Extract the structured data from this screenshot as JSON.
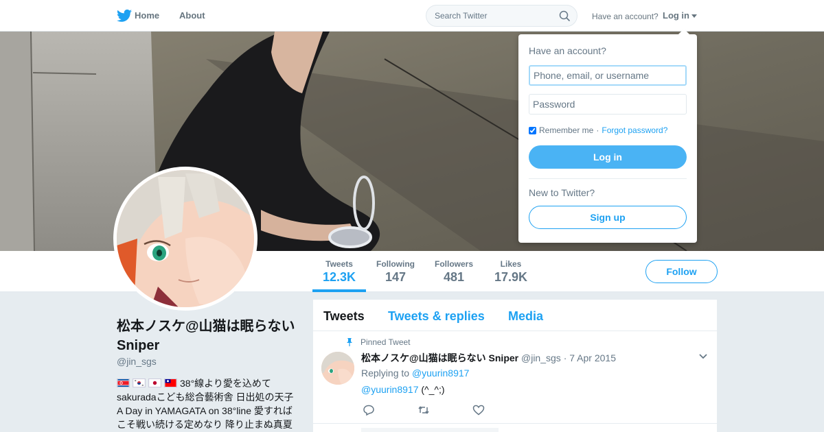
{
  "nav": {
    "home_label": "Home",
    "about_label": "About",
    "search_placeholder": "Search Twitter",
    "have_account": "Have an account?",
    "login_label": "Log in"
  },
  "profile": {
    "name": "松本ノスケ@山猫は眠らない Sniper",
    "handle": "@jin_sgs",
    "bio_flags": [
      "north-korea-flag",
      "south-korea-flag",
      "japan-flag",
      "taiwan-flag"
    ],
    "bio_text": "38°線より愛を込めて sakuradaこども総合藝術舎 日出処の天子 A Day in YAMAGATA on 38°line 愛すればこそ戦い続ける定めなり 降り止まぬ真夏"
  },
  "stats": [
    {
      "label": "Tweets",
      "value": "12.3K",
      "active": true
    },
    {
      "label": "Following",
      "value": "147",
      "active": false
    },
    {
      "label": "Followers",
      "value": "481",
      "active": false
    },
    {
      "label": "Likes",
      "value": "17.9K",
      "active": false
    }
  ],
  "follow_label": "Follow",
  "tabs": [
    "Tweets",
    "Tweets & replies",
    "Media"
  ],
  "tweet": {
    "pinned_label": "Pinned Tweet",
    "author": "松本ノスケ@山猫は眠らない Sniper",
    "handle": "@jin_sgs",
    "separator": "·",
    "date": "7 Apr 2015",
    "replying_to_prefix": "Replying to",
    "replying_to": "@yuurin8917",
    "mention": "@yuurin8917",
    "text": "(^_^;)",
    "actions": [
      "reply-icon",
      "retweet-icon",
      "like-icon"
    ]
  },
  "login_dropdown": {
    "title": "Have an account?",
    "username_placeholder": "Phone, email, or username",
    "password_placeholder": "Password",
    "remember_label": "Remember me",
    "separator": "·",
    "forgot_label": "Forgot password?",
    "login_button": "Log in",
    "new_label": "New to Twitter?",
    "signup_button": "Sign up"
  },
  "colors": {
    "accent": "#1da1f2",
    "login_button": "#4ab3f4",
    "background": "#e6ecf0",
    "muted_text": "#657786"
  }
}
